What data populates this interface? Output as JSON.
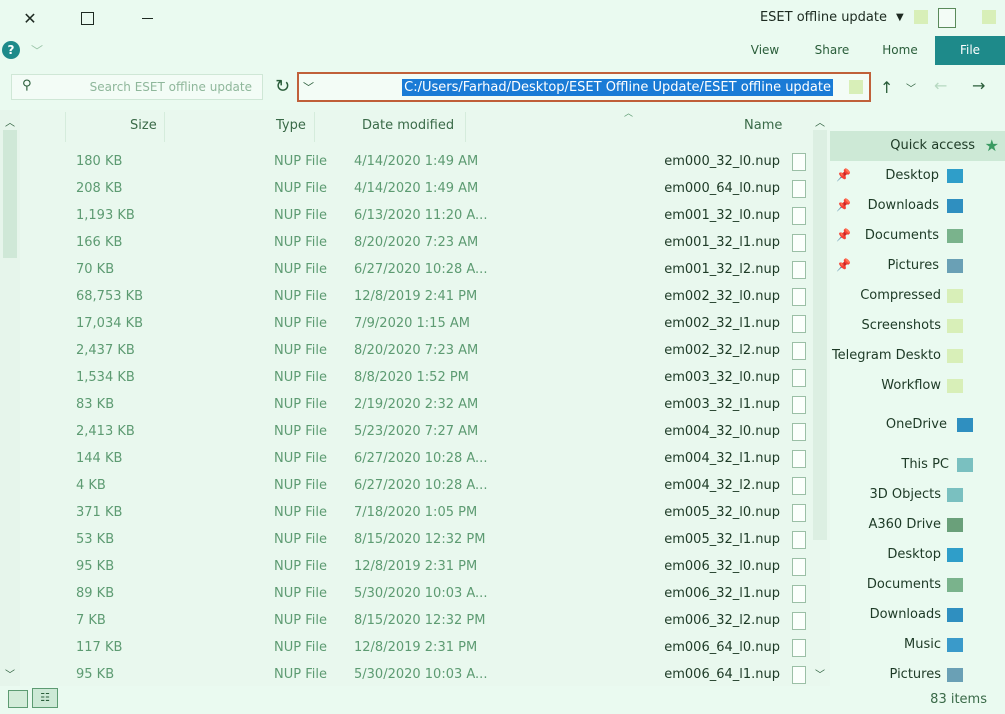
{
  "window": {
    "title": "ESET offline update"
  },
  "ribbon": {
    "tabs": [
      "File",
      "Home",
      "Share",
      "View"
    ]
  },
  "address": {
    "path": "C:/Users/Farhad/Desktop/ESET Offline Update/ESET offline update"
  },
  "search": {
    "placeholder": "Search ESET offline update"
  },
  "columns": {
    "name": "Name",
    "date": "Date modified",
    "type": "Type",
    "size": "Size"
  },
  "files": [
    {
      "name": "em000_32_l0.nup",
      "date": "4/14/2020 1:49 AM",
      "type": "NUP File",
      "size": "180 KB"
    },
    {
      "name": "em000_64_l0.nup",
      "date": "4/14/2020 1:49 AM",
      "type": "NUP File",
      "size": "208 KB"
    },
    {
      "name": "em001_32_l0.nup",
      "date": "6/13/2020 11:20 A...",
      "type": "NUP File",
      "size": "1,193 KB"
    },
    {
      "name": "em001_32_l1.nup",
      "date": "8/20/2020 7:23 AM",
      "type": "NUP File",
      "size": "166 KB"
    },
    {
      "name": "em001_32_l2.nup",
      "date": "6/27/2020 10:28 A...",
      "type": "NUP File",
      "size": "70 KB"
    },
    {
      "name": "em002_32_l0.nup",
      "date": "12/8/2019 2:41 PM",
      "type": "NUP File",
      "size": "68,753 KB"
    },
    {
      "name": "em002_32_l1.nup",
      "date": "7/9/2020 1:15 AM",
      "type": "NUP File",
      "size": "17,034 KB"
    },
    {
      "name": "em002_32_l2.nup",
      "date": "8/20/2020 7:23 AM",
      "type": "NUP File",
      "size": "2,437 KB"
    },
    {
      "name": "em003_32_l0.nup",
      "date": "8/8/2020 1:52 PM",
      "type": "NUP File",
      "size": "1,534 KB"
    },
    {
      "name": "em003_32_l1.nup",
      "date": "2/19/2020 2:32 AM",
      "type": "NUP File",
      "size": "83 KB"
    },
    {
      "name": "em004_32_l0.nup",
      "date": "5/23/2020 7:27 AM",
      "type": "NUP File",
      "size": "2,413 KB"
    },
    {
      "name": "em004_32_l1.nup",
      "date": "6/27/2020 10:28 A...",
      "type": "NUP File",
      "size": "144 KB"
    },
    {
      "name": "em004_32_l2.nup",
      "date": "6/27/2020 10:28 A...",
      "type": "NUP File",
      "size": "4 KB"
    },
    {
      "name": "em005_32_l0.nup",
      "date": "7/18/2020 1:05 PM",
      "type": "NUP File",
      "size": "371 KB"
    },
    {
      "name": "em005_32_l1.nup",
      "date": "8/15/2020 12:32 PM",
      "type": "NUP File",
      "size": "53 KB"
    },
    {
      "name": "em006_32_l0.nup",
      "date": "12/8/2019 2:31 PM",
      "type": "NUP File",
      "size": "95 KB"
    },
    {
      "name": "em006_32_l1.nup",
      "date": "5/30/2020 10:03 A...",
      "type": "NUP File",
      "size": "89 KB"
    },
    {
      "name": "em006_32_l2.nup",
      "date": "8/15/2020 12:32 PM",
      "type": "NUP File",
      "size": "7 KB"
    },
    {
      "name": "em006_64_l0.nup",
      "date": "12/8/2019 2:31 PM",
      "type": "NUP File",
      "size": "117 KB"
    },
    {
      "name": "em006_64_l1.nup",
      "date": "5/30/2020 10:03 A...",
      "type": "NUP File",
      "size": "95 KB"
    }
  ],
  "nav": {
    "quick_access": "Quick access",
    "pinned": [
      "Desktop",
      "Downloads",
      "Documents",
      "Pictures"
    ],
    "folders": [
      "Compressed",
      "Screenshots",
      "Telegram Deskto",
      "Workflow"
    ],
    "onedrive": "OneDrive",
    "this_pc": "This PC",
    "pc_items": [
      "3D Objects",
      "A360 Drive",
      "Desktop",
      "Documents",
      "Downloads",
      "Music",
      "Pictures"
    ]
  },
  "status": {
    "items": "83 items"
  },
  "icons": {
    "close": "close-icon",
    "maximize": "maximize-icon",
    "minimize": "minimize-icon",
    "help": "help-icon",
    "search": "search-icon",
    "refresh": "refresh-icon"
  },
  "colors": {
    "accent": "#1e8a8a",
    "address_border": "#c0603a",
    "selection": "#1a7bd6"
  }
}
